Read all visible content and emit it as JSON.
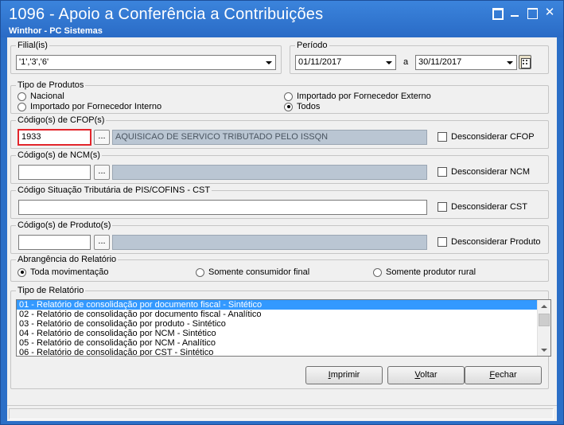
{
  "window": {
    "title": "1096 - Apoio a Conferência a Contribuições",
    "subtitle": "Winthor - PC Sistemas",
    "controls": [
      "restore-icon",
      "minimize-icon",
      "maximize-icon",
      "close-icon"
    ],
    "close_glyph": "✕"
  },
  "filial": {
    "legend": "Filial(is)",
    "value": "'1','3','6'"
  },
  "periodo": {
    "legend": "Período",
    "start": "01/11/2017",
    "separator": "a",
    "end": "30/11/2017"
  },
  "tipo_produtos": {
    "legend": "Tipo de Produtos",
    "options": [
      {
        "label": "Nacional",
        "selected": false
      },
      {
        "label": "Importado por Fornecedor Externo",
        "selected": false
      },
      {
        "label": "Importado por Fornecedor Interno",
        "selected": false
      },
      {
        "label": "Todos",
        "selected": true
      }
    ]
  },
  "cfop": {
    "legend": "Código(s) de CFOP(s)",
    "value": "1933",
    "button": "...",
    "description": "AQUISICAO DE SERVICO TRIBUTADO PELO ISSQN",
    "checkbox_label": "Desconsiderar CFOP"
  },
  "ncm": {
    "legend": "Código(s) de NCM(s)",
    "value": "",
    "button": "...",
    "description": "",
    "checkbox_label": "Desconsiderar NCM"
  },
  "cst": {
    "legend": "Código Situação Tributária de PIS/COFINS - CST",
    "value": "",
    "checkbox_label": "Desconsiderar CST"
  },
  "produto": {
    "legend": "Código(s) de Produto(s)",
    "value": "",
    "button": "...",
    "description": "",
    "checkbox_label": "Desconsiderar Produto"
  },
  "abrangencia": {
    "legend": "Abrangência do Relatório",
    "options": [
      {
        "label": "Toda movimentação",
        "selected": true
      },
      {
        "label": "Somente consumidor final",
        "selected": false
      },
      {
        "label": "Somente produtor rural",
        "selected": false
      }
    ]
  },
  "tipo_relatorio": {
    "legend": "Tipo de Relatório",
    "items": [
      "01 - Relatório de consolidação por documento fiscal - Sintético",
      "02 - Relatório de consolidação por documento fiscal - Analítico",
      "03 - Relatório de consolidação por produto - Sintético",
      "04 - Relatório de consolidação por NCM - Sintético",
      "05 - Relatório de consolidação por NCM - Analítico",
      "06 - Relatório de consolidação por CST - Sintético"
    ],
    "selected_index": 0
  },
  "buttons": {
    "imprimir": {
      "first": "I",
      "rest": "mprimir"
    },
    "voltar": {
      "first": "V",
      "rest": "oltar"
    },
    "fechar": {
      "first": "F",
      "rest": "echar"
    }
  },
  "colors": {
    "title_bar": "#2b6fc7",
    "selection": "#3399ff",
    "highlight_border": "#e2252b"
  }
}
